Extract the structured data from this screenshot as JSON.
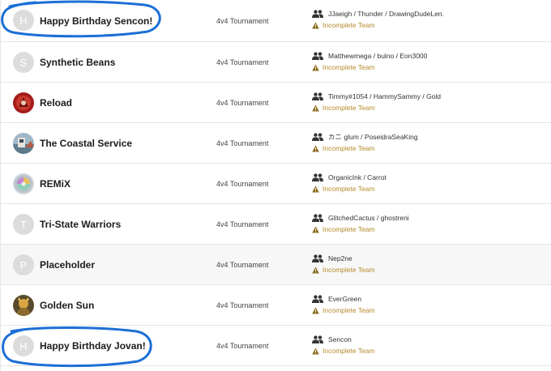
{
  "colors": {
    "status": "#b68a2c",
    "warning_icon": "#8a6a1c",
    "annotation": "#1c6fd6"
  },
  "teams": [
    {
      "avatar": "H",
      "name": "Happy Birthday Sencon!",
      "format": "4v4 Tournament",
      "members": "JJaeigh / Thunder / DrawingDudeLen.",
      "status": "Incomplete Team"
    },
    {
      "avatar": "S",
      "name": "Synthetic Beans",
      "format": "4v4 Tournament",
      "members": "Matthewmega / bulno / Eon3000",
      "status": "Incomplete Team"
    },
    {
      "avatar": "",
      "avatar_icon": "red-emblem-icon",
      "name": "Reload",
      "format": "4v4 Tournament",
      "members": "Timmy#1054 / HammySammy / Gold",
      "status": "Incomplete Team"
    },
    {
      "avatar": "",
      "avatar_icon": "coastal-scene-icon",
      "name": "The Coastal Service",
      "format": "4v4 Tournament",
      "members": "カニ glum / PoseidraSeaKing",
      "status": "Incomplete Team"
    },
    {
      "avatar": "",
      "avatar_icon": "disc-icon",
      "name": "REMiX",
      "format": "4v4 Tournament",
      "members": "OrganicInk / Carrot",
      "status": "Incomplete Team"
    },
    {
      "avatar": "T",
      "name": "Tri-State Warriors",
      "format": "4v4 Tournament",
      "members": "GlitchedCactus / ghostreni",
      "status": "Incomplete Team"
    },
    {
      "avatar": "P",
      "name": "Placeholder",
      "format": "4v4 Tournament",
      "members": "Nep2ne",
      "status": "Incomplete Team"
    },
    {
      "avatar": "",
      "avatar_icon": "golden-character-icon",
      "name": "Golden Sun",
      "format": "4v4 Tournament",
      "members": "EverGreen",
      "status": "Incomplete Team"
    },
    {
      "avatar": "H",
      "name": "Happy Birthday Jovan!",
      "format": "4v4 Tournament",
      "members": "Sencon",
      "status": "Incomplete Team"
    }
  ]
}
